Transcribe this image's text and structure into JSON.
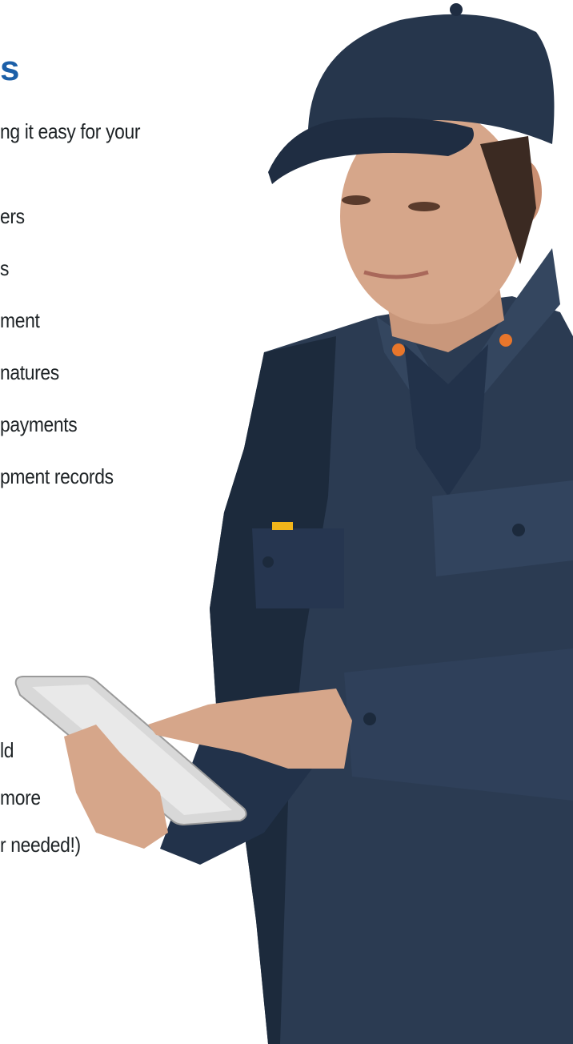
{
  "heading": {
    "fragment": "s",
    "color": "#1b5fa8"
  },
  "intro": {
    "line": "ng it easy for your"
  },
  "features_top": [
    "ers",
    "s",
    "ment",
    "natures",
    "payments",
    "pment records"
  ],
  "features_bottom": [
    "ld",
    "more",
    "r needed!)"
  ],
  "photo": {
    "subject": "technician-with-tablet",
    "colors": {
      "jacket": "#2b3b52",
      "jacket_shadow": "#1c2a3c",
      "cap": "#26364c",
      "skin": "#d6a68a",
      "tablet": "#d8d8d8",
      "accent_orange": "#e8762b",
      "pen_yellow": "#f2b51a"
    }
  }
}
